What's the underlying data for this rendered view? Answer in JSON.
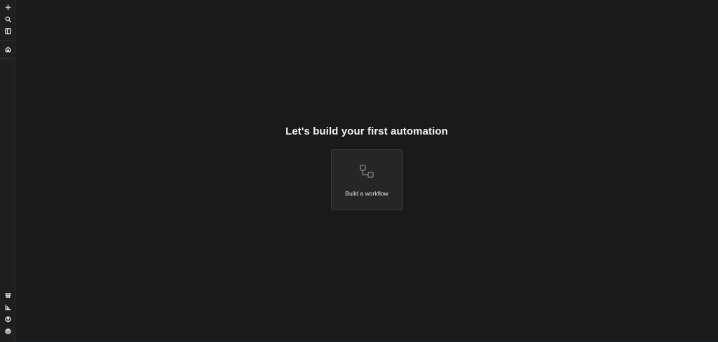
{
  "sidebar": {
    "top_icons": [
      "plus-icon",
      "search-icon",
      "sidebar-toggle-icon"
    ],
    "nav_icons": [
      "home-icon"
    ],
    "bottom_icons": [
      "templates-icon",
      "insights-icon",
      "help-icon",
      "settings-icon"
    ]
  },
  "main": {
    "heading": "Let's build your first automation",
    "card": {
      "icon": "workflow-icon",
      "label": "Build a workflow"
    }
  },
  "colors": {
    "background": "#1a1a1b",
    "sidebar": "#1f1f20",
    "card": "#262627",
    "card_border": "#3a3a3c",
    "text": "#f2f2f2"
  }
}
